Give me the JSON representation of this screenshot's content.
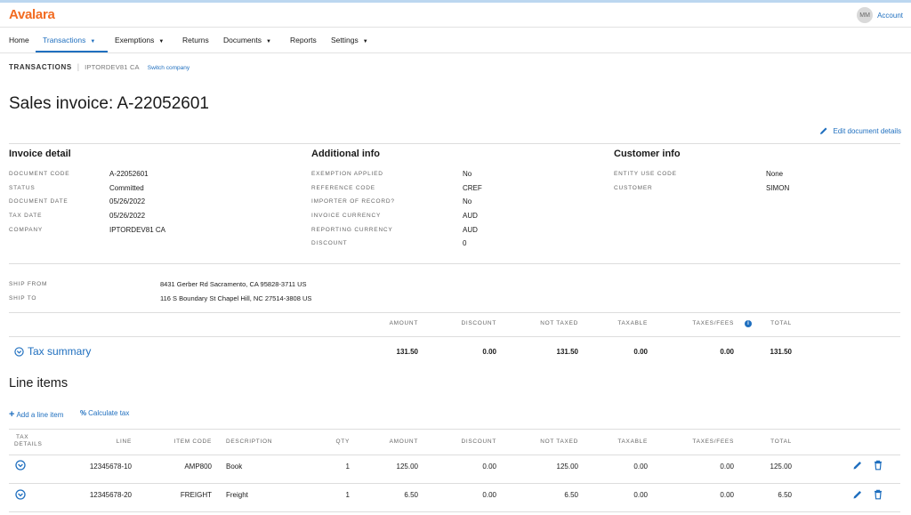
{
  "app": {
    "logo": "Avalara",
    "avatar_initials": "MM",
    "account_label": "Account"
  },
  "nav": {
    "items": [
      {
        "label": "Home"
      },
      {
        "label": "Transactions",
        "caret": "▼"
      },
      {
        "label": "Exemptions",
        "caret": "▼"
      },
      {
        "label": "Returns"
      },
      {
        "label": "Documents",
        "caret": "▼"
      },
      {
        "label": "Reports"
      },
      {
        "label": "Settings",
        "caret": "▼"
      }
    ]
  },
  "breadcrumb": {
    "section": "TRANSACTIONS",
    "separator": "|",
    "company": "IPTORDEV81 CA",
    "switch_label": "Switch company"
  },
  "page_title": "Sales invoice: A-22052601",
  "edit_document_label": "Edit document details",
  "invoice_detail": {
    "heading": "Invoice detail",
    "fields": [
      {
        "label": "DOCUMENT CODE",
        "value": "A-22052601"
      },
      {
        "label": "STATUS",
        "value": "Committed"
      },
      {
        "label": "DOCUMENT DATE",
        "value": "05/26/2022"
      },
      {
        "label": "TAX DATE",
        "value": "05/26/2022"
      },
      {
        "label": "COMPANY",
        "value": "IPTORDEV81 CA"
      }
    ]
  },
  "additional_info": {
    "heading": "Additional info",
    "fields": [
      {
        "label": "EXEMPTION APPLIED",
        "value": "No"
      },
      {
        "label": "REFERENCE CODE",
        "value": "CREF"
      },
      {
        "label": "IMPORTER OF RECORD?",
        "value": "No"
      },
      {
        "label": "INVOICE CURRENCY",
        "value": "AUD"
      },
      {
        "label": "REPORTING CURRENCY",
        "value": "AUD"
      },
      {
        "label": "DISCOUNT",
        "value": "0"
      }
    ]
  },
  "customer_info": {
    "heading": "Customer info",
    "fields": [
      {
        "label": "ENTITY USE CODE",
        "value": "None"
      },
      {
        "label": "CUSTOMER",
        "value": "SIMON"
      }
    ]
  },
  "addresses": [
    {
      "label": "SHIP FROM",
      "value": "8431 Gerber Rd Sacramento, CA 95828-3711 US"
    },
    {
      "label": "SHIP TO",
      "value": "116 S Boundary St Chapel Hill, NC 27514-3808 US"
    }
  ],
  "summary": {
    "columns": [
      "AMOUNT",
      "DISCOUNT",
      "NOT TAXED",
      "TAXABLE",
      "TAXES/FEES",
      "TOTAL"
    ],
    "info_icon_glyph": "i",
    "label": "Tax summary",
    "values": [
      "131.50",
      "0.00",
      "131.50",
      "0.00",
      "0.00",
      "131.50"
    ]
  },
  "line_items": {
    "heading": "Line items",
    "add_label": "Add a line item",
    "calc_label": "Calculate tax",
    "columns": {
      "tax_details_1": "TAX",
      "tax_details_2": "DETAILS",
      "line": "LINE",
      "item_code": "ITEM CODE",
      "description": "DESCRIPTION",
      "qty": "QTY",
      "amount": "AMOUNT",
      "discount": "DISCOUNT",
      "not_taxed": "NOT TAXED",
      "taxable": "TAXABLE",
      "taxes_fees": "TAXES/FEES",
      "total": "TOTAL"
    },
    "rows": [
      {
        "line": "12345678-10",
        "item_code": "AMP800",
        "description": "Book",
        "qty": "1",
        "amount": "125.00",
        "discount": "0.00",
        "not_taxed": "125.00",
        "taxable": "0.00",
        "taxes_fees": "0.00",
        "total": "125.00"
      },
      {
        "line": "12345678-20",
        "item_code": "FREIGHT",
        "description": "Freight",
        "qty": "1",
        "amount": "6.50",
        "discount": "0.00",
        "not_taxed": "6.50",
        "taxable": "0.00",
        "taxes_fees": "0.00",
        "total": "6.50"
      }
    ]
  },
  "colors": {
    "brand": "#f26b21",
    "link": "#1f6fbf",
    "divider": "#dddddd"
  },
  "icons": [
    "pencil-icon",
    "trash-icon",
    "chevron-circle-down-icon",
    "info-icon",
    "plus-icon",
    "percent-icon"
  ]
}
